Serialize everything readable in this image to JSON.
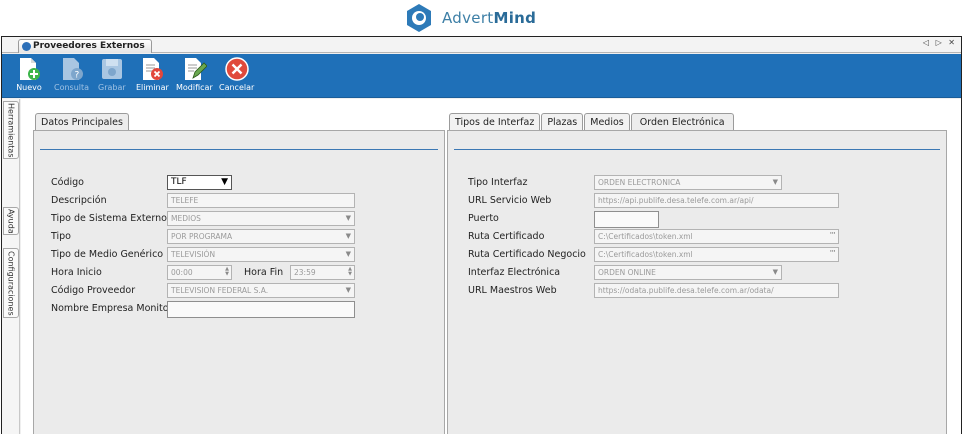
{
  "brand": {
    "name_light": "Advert",
    "name_bold": "Mind"
  },
  "doc_tab": {
    "label": "Proveedores Externos"
  },
  "nav_controls": "◁ ▷ ✕",
  "toolbar": {
    "buttons": [
      {
        "label": "Nuevo",
        "icon": "new-doc-icon",
        "enabled": true
      },
      {
        "label": "Consulta",
        "icon": "query-doc-icon",
        "enabled": false
      },
      {
        "label": "Grabar",
        "icon": "save-disk-icon",
        "enabled": false
      },
      {
        "label": "Eliminar",
        "icon": "delete-doc-icon",
        "enabled": true
      },
      {
        "label": "Modificar",
        "icon": "edit-doc-icon",
        "enabled": true
      },
      {
        "label": "Cancelar",
        "icon": "cancel-circle-icon",
        "enabled": true
      }
    ]
  },
  "side_tabs": [
    "Herramientas",
    "Ayuda",
    "Configuraciones"
  ],
  "left_panel": {
    "tab": "Datos Principales",
    "fields": {
      "codigo": {
        "label": "Código",
        "value": "TLF"
      },
      "descripcion": {
        "label": "Descripción",
        "value": "TELEFE"
      },
      "tipo_sistema": {
        "label": "Tipo de Sistema Externo",
        "value": "MEDIOS"
      },
      "tipo": {
        "label": "Tipo",
        "value": "POR PROGRAMA"
      },
      "tipo_medio": {
        "label": "Tipo de Medio Genérico",
        "value": "TELEVISIÓN"
      },
      "hora_inicio": {
        "label": "Hora Inicio",
        "value": "00:00"
      },
      "hora_fin": {
        "label": "Hora Fin",
        "value": "23:59"
      },
      "codigo_proveedor": {
        "label": "Código Proveedor",
        "value": "TELEVISION FEDERAL S.A."
      },
      "nombre_empresa": {
        "label": "Nombre Empresa Monitor",
        "value": ""
      }
    }
  },
  "right_panel": {
    "tabs": [
      "Tipos de Interfaz",
      "Plazas",
      "Medios",
      "Orden Electrónica"
    ],
    "active_tab": "Orden Electrónica",
    "fields": {
      "tipo_interfaz": {
        "label": "Tipo Interfaz",
        "value": "ORDEN ELECTRONICA"
      },
      "url_servicio": {
        "label": "URL Servicio Web",
        "value": "https://api.publife.desa.telefe.com.ar/api/"
      },
      "puerto": {
        "label": "Puerto",
        "value": ""
      },
      "ruta_certificado": {
        "label": "Ruta Certificado",
        "value": "C:\\Certificados\\token.xml"
      },
      "ruta_cert_negocio": {
        "label": "Ruta Certificado Negocio",
        "value": "C:\\Certificados\\token.xml"
      },
      "interfaz_electronica": {
        "label": "Interfaz Electrónica",
        "value": "ORDEN ONLINE"
      },
      "url_maestros": {
        "label": "URL Maestros Web",
        "value": "https://odata.publife.desa.telefe.com.ar/odata/"
      }
    }
  },
  "colors": {
    "toolbar": "#1f70b8",
    "separator": "#3c78b4",
    "brand": "#2a6b98"
  }
}
